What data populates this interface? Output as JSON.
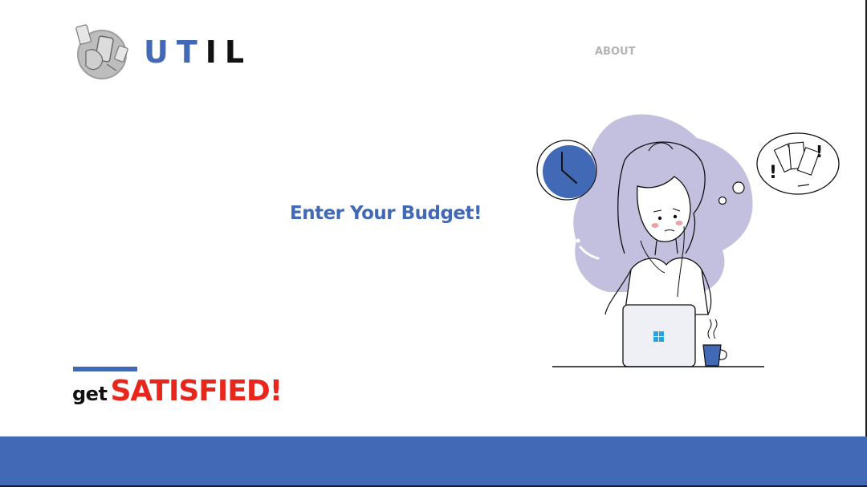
{
  "colors": {
    "accent": "#4169b5",
    "highlight": "#e8261b",
    "text": "#111111",
    "nav_muted": "#b3b3b3",
    "blob": "#c2bfdf"
  },
  "brand": {
    "letters": [
      "U",
      "T",
      "I",
      "L"
    ],
    "emblem_icon": "phones-emblem-icon"
  },
  "nav": {
    "about_label": "ABOUT"
  },
  "hero": {
    "cta_label": "Enter Your Budget!"
  },
  "tagline": {
    "lead": "get",
    "emphasis": "SATISFIED!"
  },
  "illustration": {
    "subject": "woman-at-laptop-illustration",
    "icons": [
      "wall-clock-icon",
      "money-worry-thought-icon",
      "windows-logo-icon",
      "coffee-cup-icon"
    ]
  }
}
